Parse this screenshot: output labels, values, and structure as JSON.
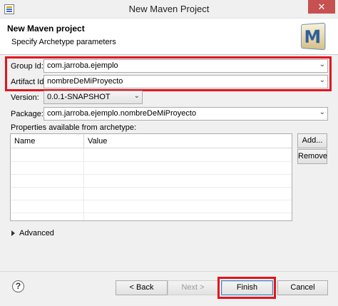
{
  "window": {
    "title": "New Maven Project",
    "close_glyph": "✕"
  },
  "header": {
    "title": "New Maven project",
    "subtitle": "Specify Archetype parameters",
    "logo_letter": "M"
  },
  "form": {
    "group_id": {
      "label": "Group Id:",
      "value": "com.jarroba.ejemplo"
    },
    "artifact_id": {
      "label": "Artifact Id:",
      "value": "nombreDeMiProyecto"
    },
    "version": {
      "label": "Version:",
      "value": "0.0.1-SNAPSHOT"
    },
    "package": {
      "label": "Package:",
      "value": "com.jarroba.ejemplo.nombreDeMiProyecto"
    }
  },
  "properties": {
    "label": "Properties available from archetype:",
    "columns": [
      "Name",
      "Value"
    ],
    "add_label": "Add...",
    "remove_label": "Remove"
  },
  "advanced": {
    "label": "Advanced"
  },
  "footer": {
    "help_glyph": "?",
    "back_label": "< Back",
    "next_label": "Next >",
    "finish_label": "Finish",
    "cancel_label": "Cancel"
  },
  "colors": {
    "highlight": "#e3141e",
    "window_bg": "#f0f0f0",
    "close_button": "#c75050"
  },
  "icons": {
    "app": "app-icon",
    "logo": "maven-logo-icon",
    "help": "help-icon",
    "dropdown": "chevron-down-icon",
    "expand": "expand-triangle-icon"
  }
}
